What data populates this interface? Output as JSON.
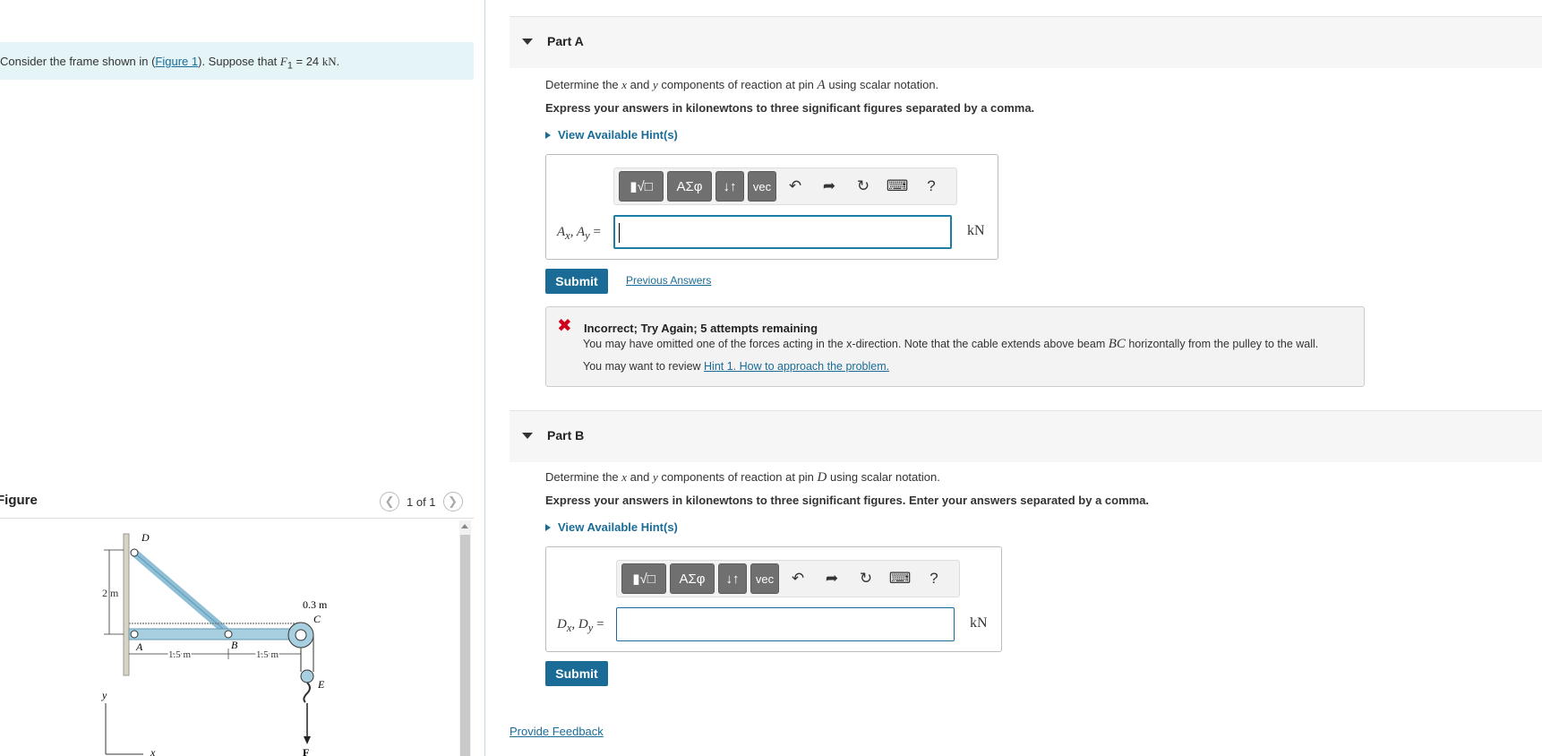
{
  "intro": {
    "prefix": "Consider the frame shown in (",
    "figure_link": "Figure 1",
    "mid": "). Suppose that ",
    "var": "F",
    "sub": "1",
    "rest": " = 24 ",
    "unit": "kN",
    "end": "."
  },
  "figure": {
    "title": "Figure",
    "pager": "1 of 1",
    "labels": {
      "D": "D",
      "A": "A",
      "B": "B",
      "C": "C",
      "E": "E",
      "F": "F",
      "y": "y",
      "x": "x",
      "dim_2m": "2 m",
      "dim_03m": "0.3 m",
      "dim_15a": "1.5 m",
      "dim_15b": "1.5  m"
    }
  },
  "partA": {
    "label": "Part A",
    "q_pre": "Determine the ",
    "q_x": "x",
    "q_and": " and ",
    "q_y": "y",
    "q_mid": " components of reaction at pin ",
    "q_pin": "A",
    "q_post": " using scalar notation.",
    "instr": "Express your answers in kilonewtons to three significant figures separated by a comma.",
    "hint": "View Available Hint(s)",
    "var_label": "A",
    "unit": "kN",
    "submit": "Submit",
    "prev_answers": "Previous Answers",
    "fb_title": "Incorrect; Try Again; 5 attempts remaining",
    "fb_msg_pre": "You may have omitted one of the forces acting in the x-direction. Note that the cable extends above beam ",
    "fb_msg_beam": "BC",
    "fb_msg_post": " horizontally from the pulley to the wall.",
    "fb_review_pre": "You may want to review ",
    "fb_review_link": "Hint 1. How to approach the problem."
  },
  "partB": {
    "label": "Part B",
    "q_pre": "Determine the ",
    "q_x": "x",
    "q_and": " and ",
    "q_y": "y",
    "q_mid": " components of reaction at pin ",
    "q_pin": "D",
    "q_post": " using scalar notation.",
    "instr": "Express your answers in kilonewtons to three significant figures. Enter your answers separated by a comma.",
    "hint": "View Available Hint(s)",
    "var_label": "D",
    "unit": "kN",
    "submit": "Submit"
  },
  "toolbar": {
    "templates": "▮√□",
    "greek": "ΑΣφ",
    "arrows": "↓↑",
    "vec": "vec",
    "undo_icon": "undo-icon",
    "redo_icon": "redo-icon",
    "reset_icon": "reset-icon",
    "keyboard_icon": "keyboard-icon",
    "help": "?"
  },
  "provide_feedback": "Provide Feedback",
  "colors": {
    "accent": "#1a6c97",
    "intro_bg": "#e5f4f6",
    "error": "#d0021b",
    "beam": "#a8cfe0"
  }
}
